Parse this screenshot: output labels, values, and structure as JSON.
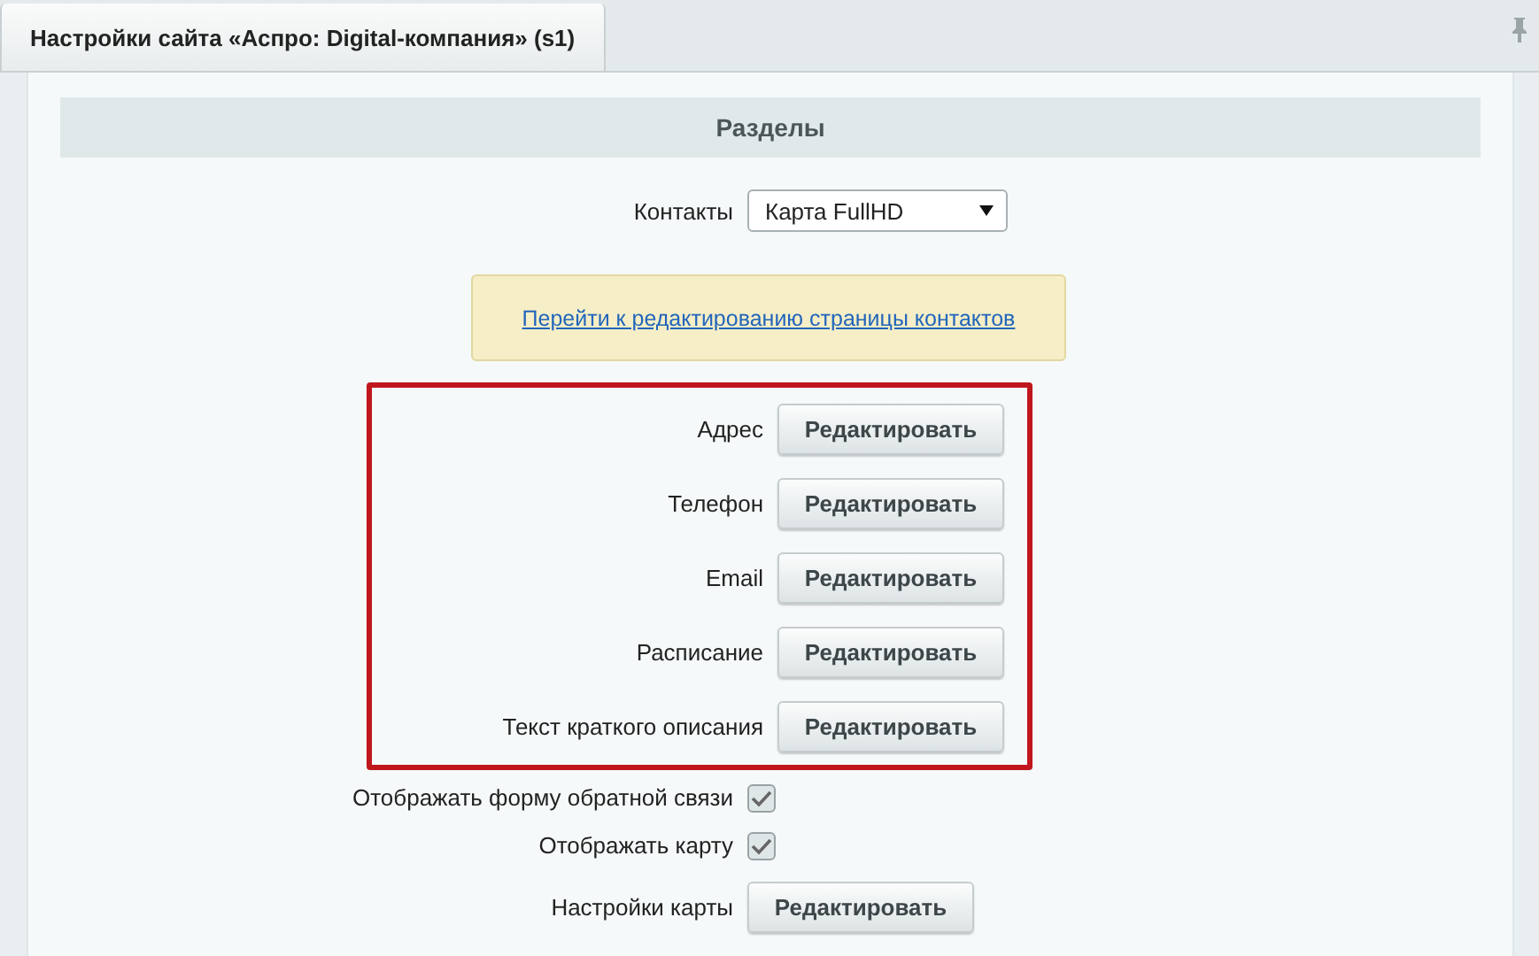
{
  "tabs": [
    {
      "label": "Настройки сайта «Аспро: Digital-компания» (s1)",
      "selected": true
    }
  ],
  "section": {
    "title": "Разделы"
  },
  "rows": [
    {
      "kind": "select",
      "label": "Контакты",
      "value": "Карта FullHD"
    },
    {
      "kind": "note",
      "link": "Перейти к редактированию страницы контактов"
    },
    {
      "kind": "group",
      "highlighted": true,
      "rows": [
        {
          "label": "Адрес",
          "button": "Редактировать"
        },
        {
          "label": "Телефон",
          "button": "Редактировать"
        },
        {
          "label": "Email",
          "button": "Редактировать"
        },
        {
          "label": "Расписание",
          "button": "Редактировать"
        },
        {
          "label": "Текст краткого описания",
          "button": "Редактировать"
        }
      ]
    },
    {
      "kind": "checkbox",
      "label": "Отображать форму обратной связи",
      "checked": true
    },
    {
      "kind": "checkbox",
      "label": "Отображать карту",
      "checked": true
    },
    {
      "kind": "button",
      "label": "Настройки карты",
      "button": "Редактировать"
    }
  ]
}
